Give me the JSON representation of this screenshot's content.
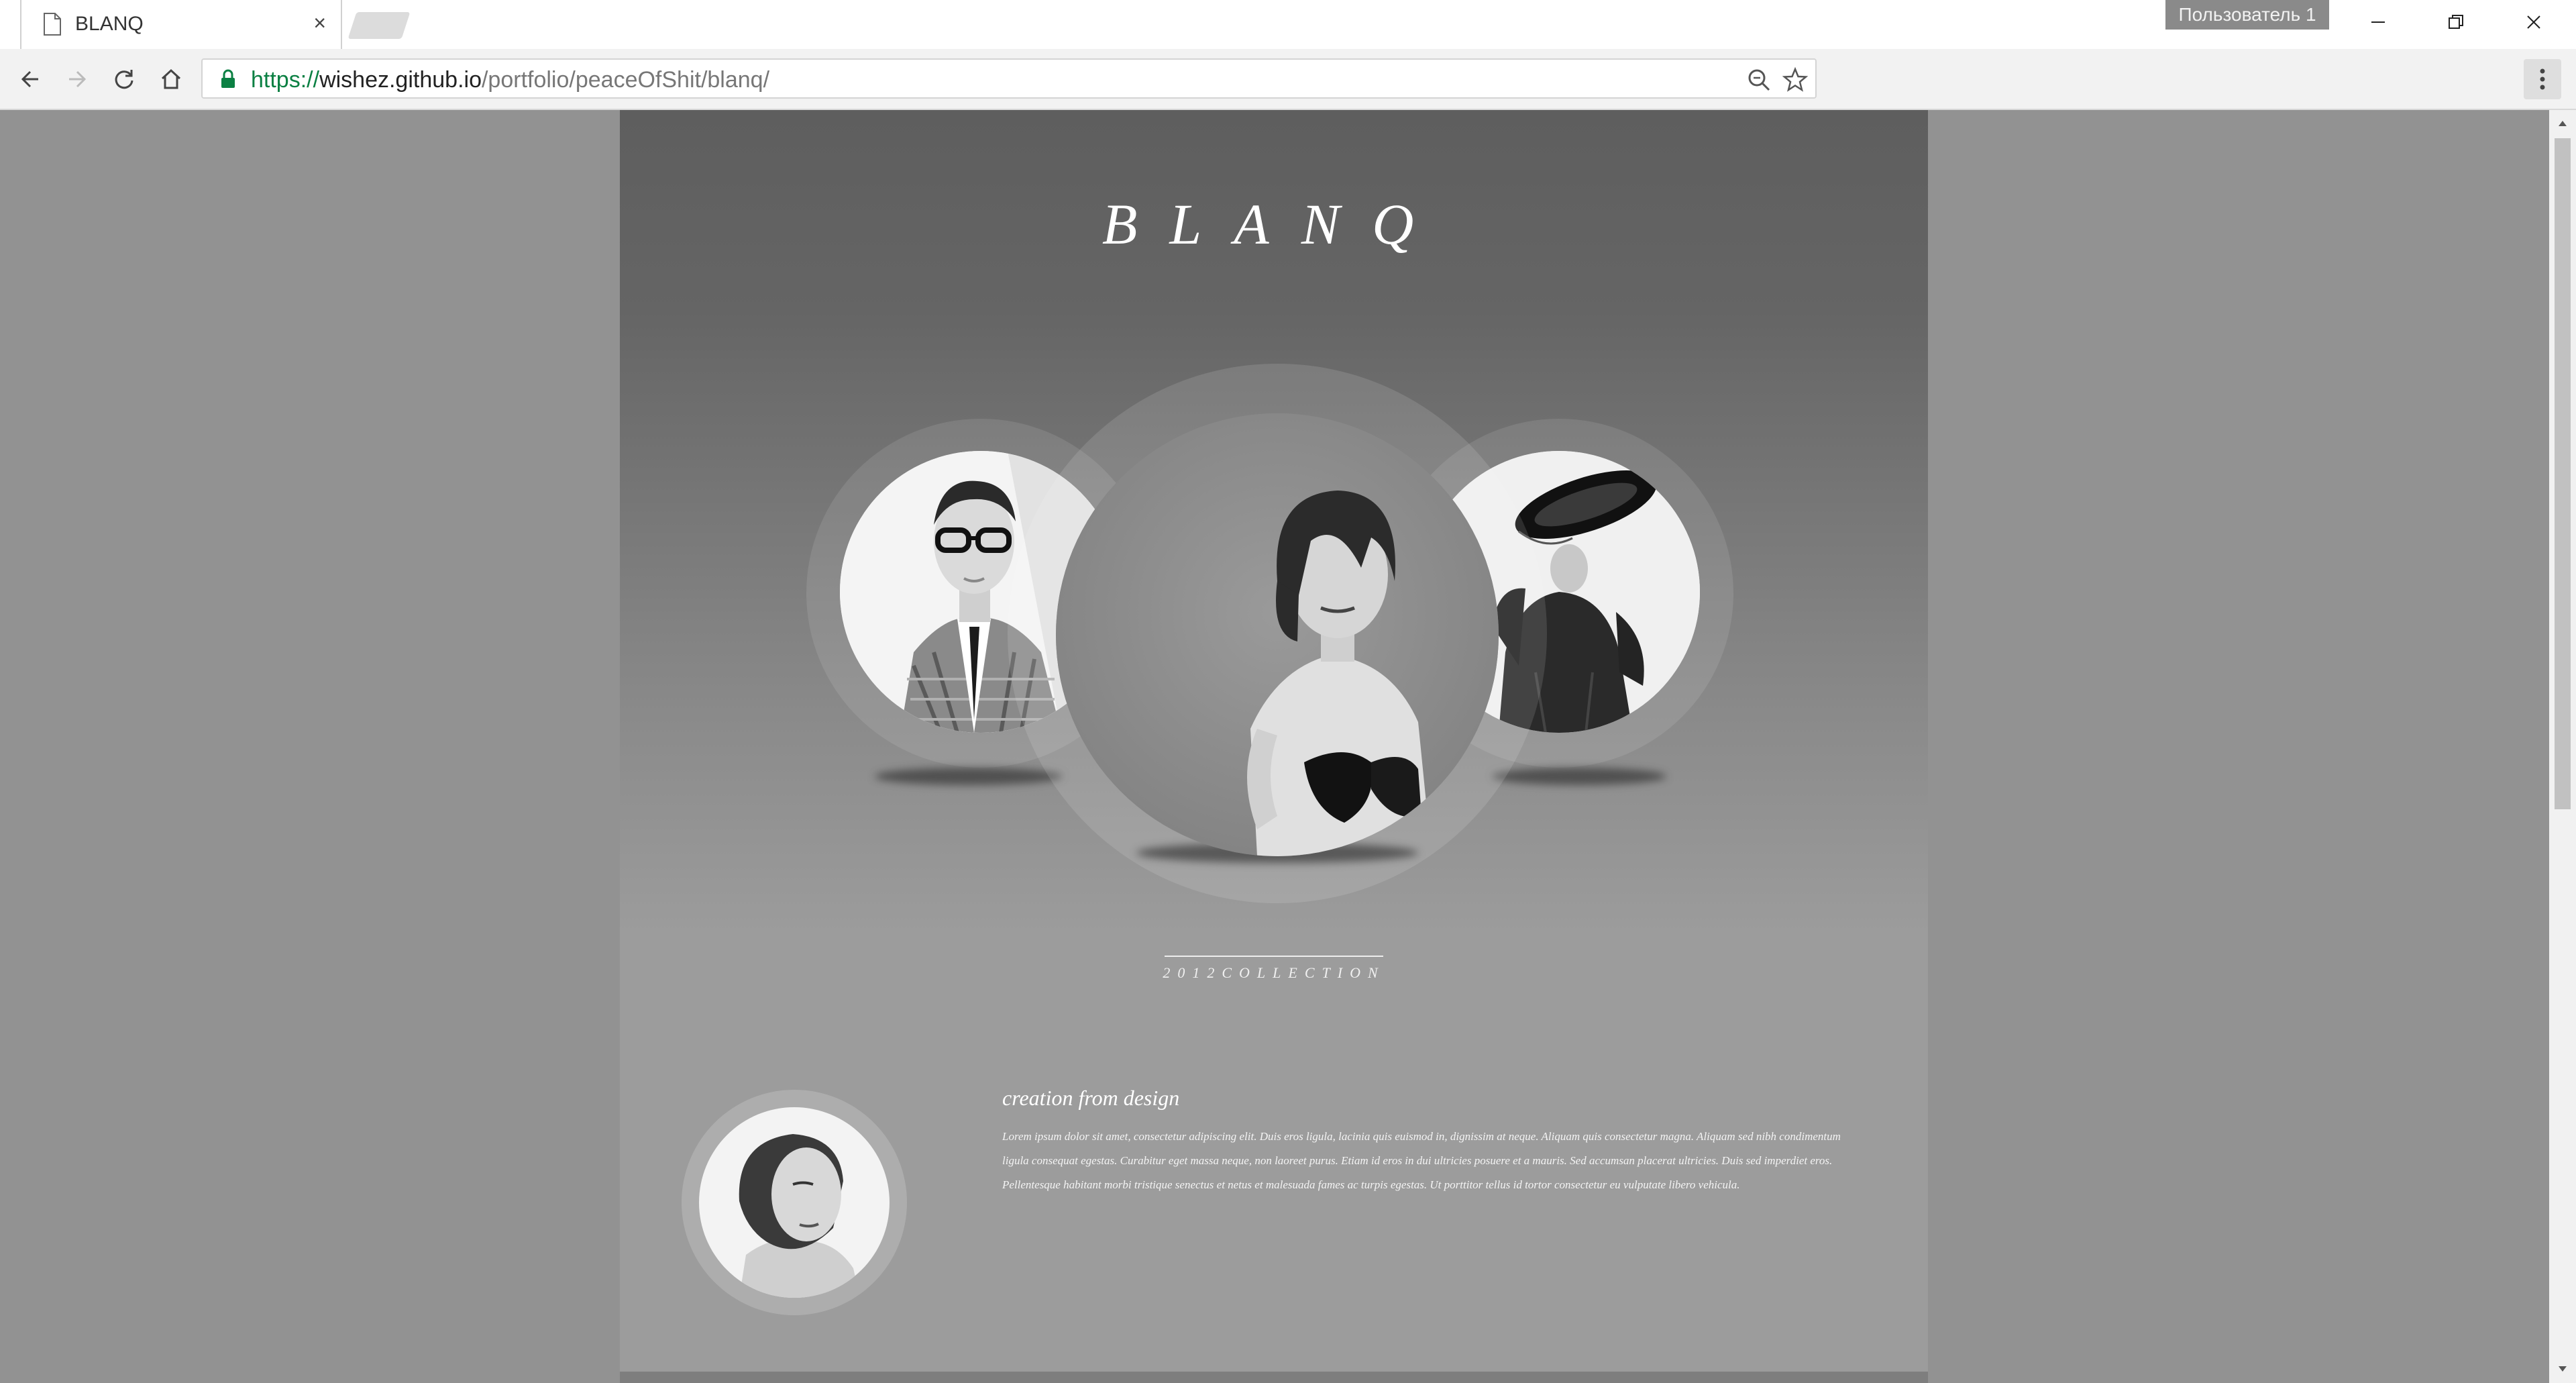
{
  "browser": {
    "tab": {
      "title": "BLANQ",
      "close_glyph": "×",
      "icon": "document-icon"
    },
    "profile_label": "Пользователь 1",
    "url": {
      "scheme": "https://",
      "host": "wishez.github.io",
      "path": "/portfolio/peaceOfShit/blanq/"
    },
    "icons": [
      "back-icon",
      "forward-icon",
      "reload-icon",
      "home-icon",
      "lock-icon",
      "zoom-icon",
      "star-icon",
      "menu-icon",
      "minimize-icon",
      "restore-icon",
      "close-icon"
    ],
    "colors": {
      "secure_green": "#0b8043"
    }
  },
  "page": {
    "logo": "BLANQ",
    "collection": "2012COLLECTION",
    "about": {
      "title": "creation from design",
      "body": "Lorem ipsum dolor sit amet, consectetur adipiscing elit. Duis eros ligula, lacinia quis euismod in, dignissim at neque. Aliquam quis consectetur magna. Aliquam sed nibh condimentum ligula consequat egestas. Curabitur eget massa neque, non laoreet purus. Etiam id eros in dui ultricies posuere et a mauris. Sed accumsan placerat ultricies. Duis sed imperdiet eros. Pellentesque habitant morbi tristique senectus et netus et malesuada fames ac turpis egestas. Ut porttitor tellus id tortor consectetur eu vulputate libero vehicula."
    },
    "colors": {
      "background": "#929292",
      "panel_top": "#5e5e5e",
      "panel_bottom": "#9c9c9c",
      "text": "#ffffff"
    }
  }
}
